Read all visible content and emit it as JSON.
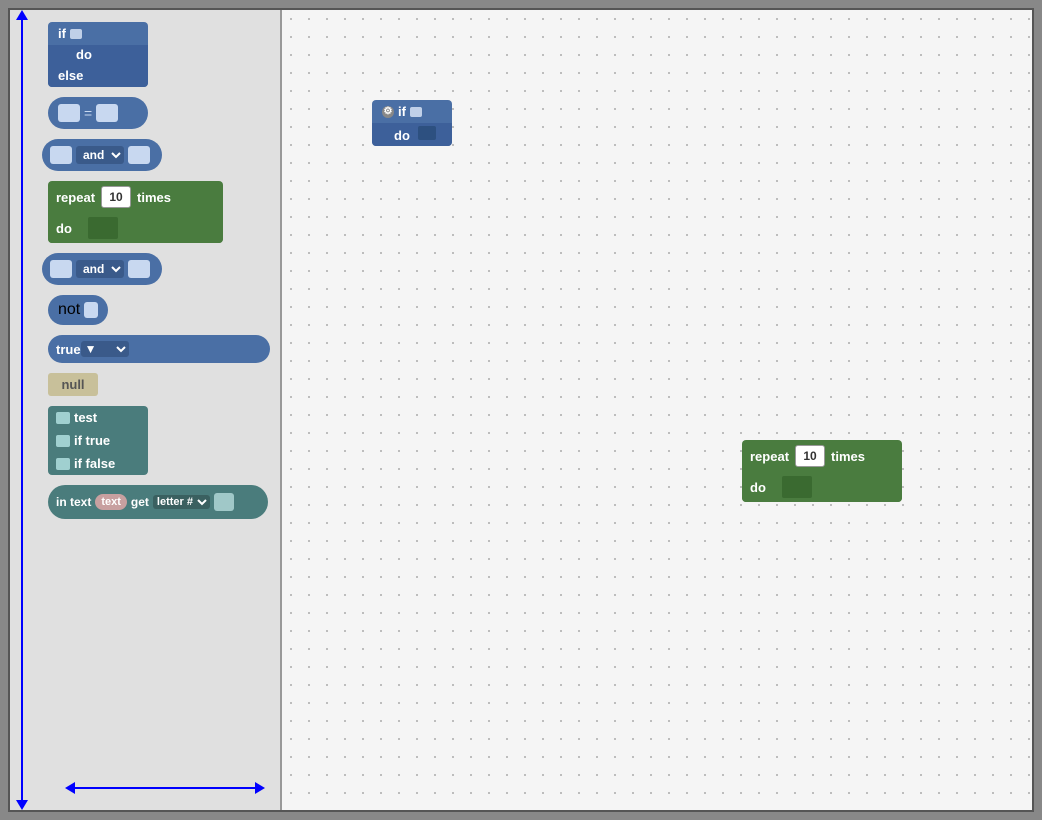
{
  "sidebar": {
    "if_label": "if",
    "do_label": "do",
    "else_label": "else",
    "and_label": "and",
    "and2_label": "and",
    "repeat_label": "repeat",
    "times_label": "times",
    "do2_label": "do",
    "not_label": "not",
    "true_label": "true",
    "null_label": "null",
    "test_label": "test",
    "if_true_label": "if true",
    "if_false_label": "if false",
    "in_text_label": "in text",
    "text_slot_label": "text",
    "get_label": "get",
    "letter_label": "letter #",
    "repeat_number": "10"
  },
  "canvas": {
    "if_block": {
      "if_label": "if",
      "do_label": "do"
    },
    "repeat_block": {
      "repeat_label": "repeat",
      "number": "10",
      "times_label": "times",
      "do_label": "do"
    }
  }
}
